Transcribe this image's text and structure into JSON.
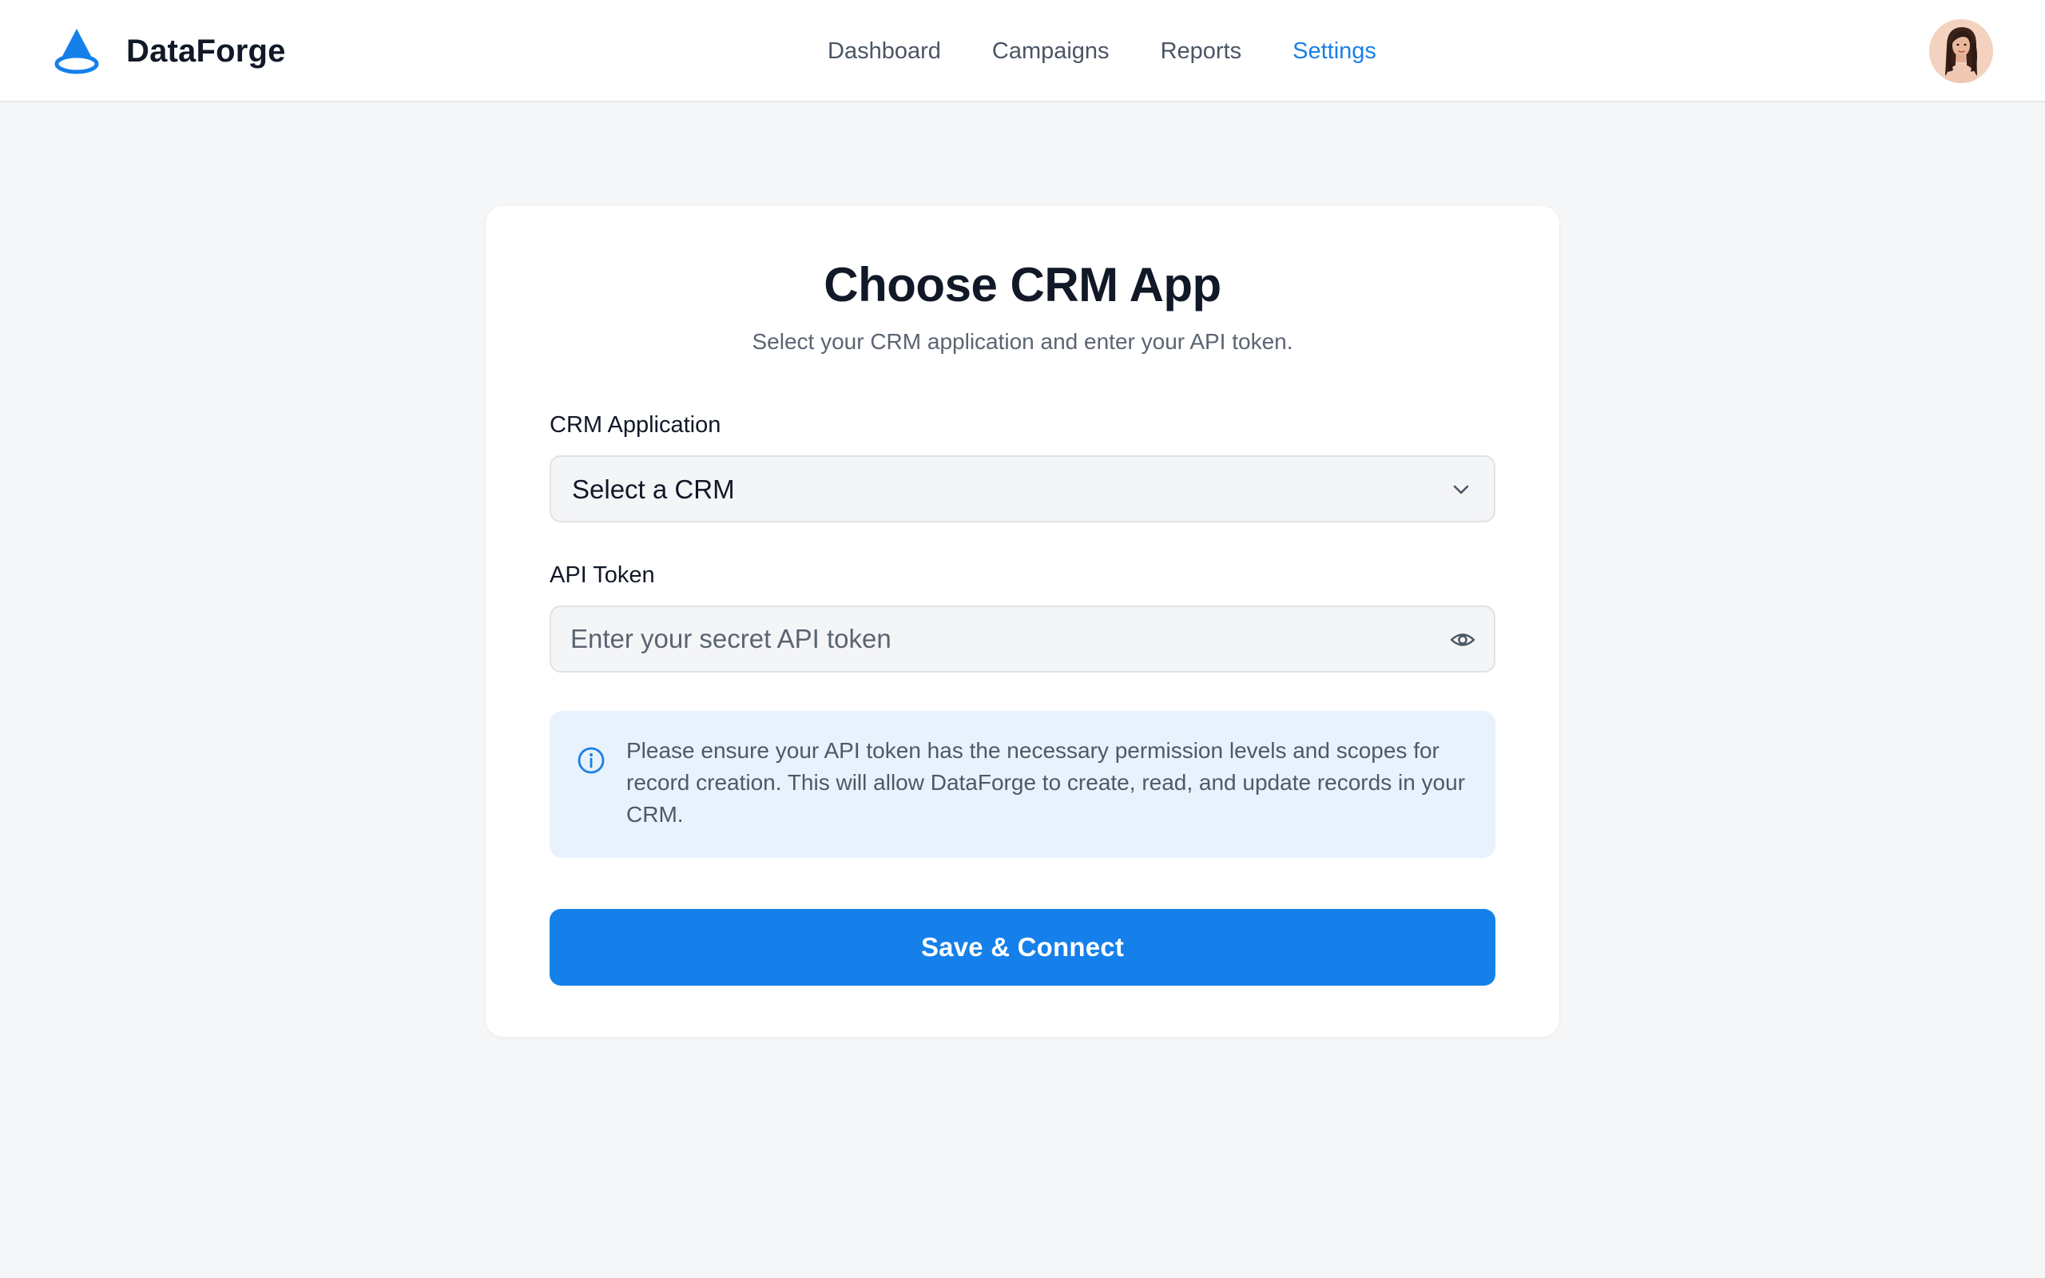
{
  "app": {
    "name": "DataForge",
    "logo_icon": "cone-logo-icon",
    "accent_color": "#1a7fe8"
  },
  "nav": {
    "items": [
      {
        "label": "Dashboard",
        "active": false
      },
      {
        "label": "Campaigns",
        "active": false
      },
      {
        "label": "Reports",
        "active": false
      },
      {
        "label": "Settings",
        "active": true
      }
    ]
  },
  "user": {
    "avatar_icon": "user-avatar"
  },
  "form": {
    "title": "Choose CRM App",
    "subtitle": "Select your CRM application and enter your API token.",
    "crm_field": {
      "label": "CRM Application",
      "selected_value": "Select a CRM",
      "icon": "chevron-down-icon"
    },
    "token_field": {
      "label": "API Token",
      "value": "",
      "placeholder": "Enter your secret API token",
      "icon": "eye-icon"
    },
    "info": {
      "icon": "info-icon",
      "text": "Please ensure your API token has the necessary permission levels and scopes for record creation. This will allow DataForge to create, read, and update records in your CRM.",
      "background_color": "#e8f2fc"
    },
    "submit_label": "Save & Connect",
    "submit_color": "#1580ea"
  }
}
